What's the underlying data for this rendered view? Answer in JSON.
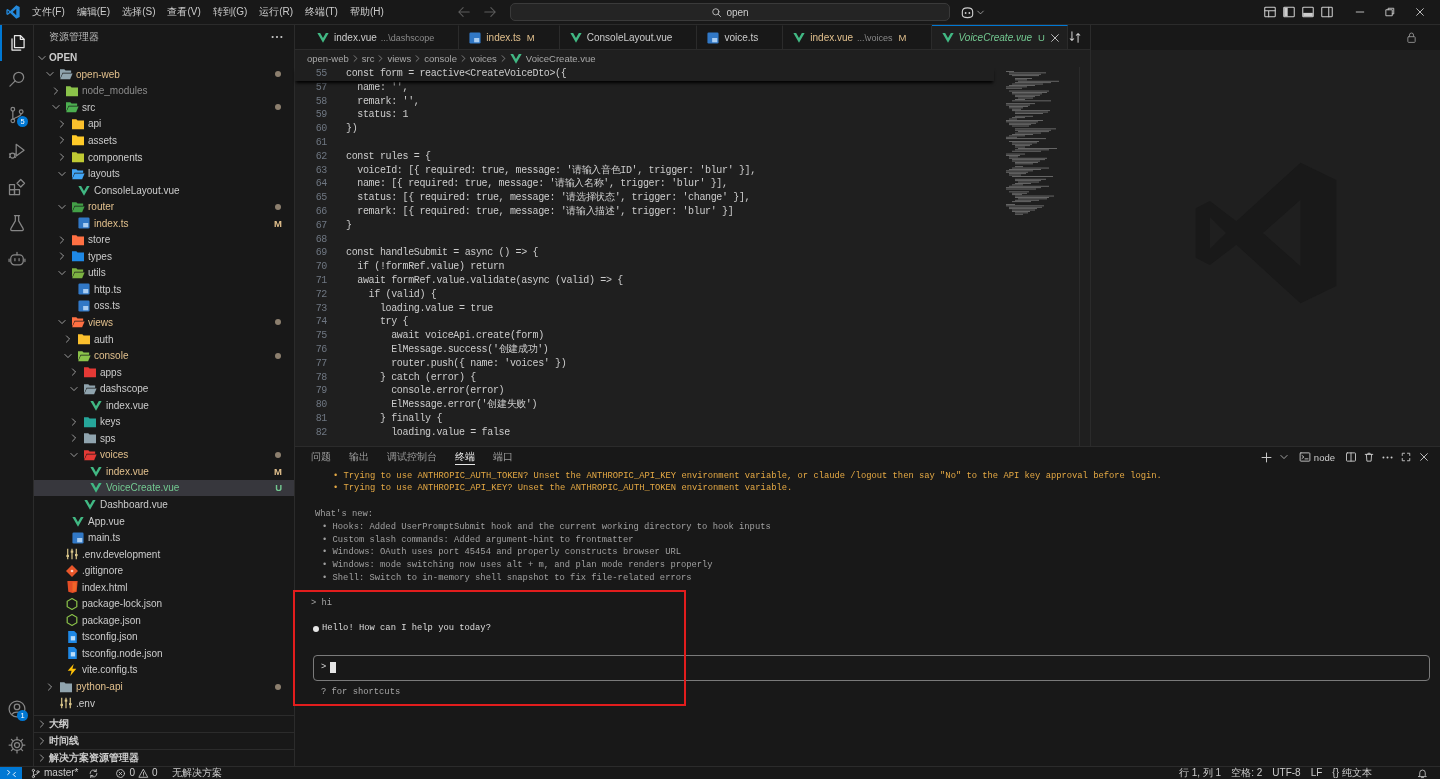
{
  "title_bar": {
    "menu": [
      "文件(F)",
      "编辑(E)",
      "选择(S)",
      "查看(V)",
      "转到(G)",
      "运行(R)",
      "终端(T)",
      "帮助(H)"
    ],
    "nav": [
      {
        "kind": "back",
        "disabled": true
      },
      {
        "kind": "forward",
        "disabled": true
      }
    ],
    "command_center": "open"
  },
  "activity_bar": {
    "top": [
      {
        "kind": "explorer",
        "selected": true
      },
      {
        "kind": "search",
        "selected": false
      },
      {
        "kind": "source-control",
        "selected": false,
        "badge": "5"
      },
      {
        "kind": "run",
        "selected": false
      },
      {
        "kind": "extensions",
        "selected": false
      },
      {
        "kind": "testing",
        "selected": false
      },
      {
        "kind": "chat",
        "selected": false
      }
    ],
    "bottom": [
      {
        "kind": "account",
        "badge": "1"
      },
      {
        "kind": "settings"
      }
    ]
  },
  "sidebar": {
    "title": "资源管理器",
    "sections": [
      {
        "title": "OPEN",
        "expanded": true,
        "tree": [
          {
            "name": "open-web",
            "kind": "folder",
            "color": "#90a4ae",
            "expanded": true,
            "modified": true,
            "dot": true,
            "selected": false,
            "children": [
              {
                "name": "node_modules",
                "kind": "folder",
                "color": "#8bc34a",
                "expanded": false,
                "ignored": true,
                "selected": false
              },
              {
                "name": "src",
                "kind": "folder",
                "color": "#4caf50",
                "expanded": true,
                "dot": true,
                "selected": false,
                "children": [
                  {
                    "name": "api",
                    "kind": "folder",
                    "color": "#fbc02d",
                    "expanded": false,
                    "selected": false
                  },
                  {
                    "name": "assets",
                    "kind": "folder",
                    "color": "#ffca28",
                    "expanded": false,
                    "selected": false
                  },
                  {
                    "name": "components",
                    "kind": "folder",
                    "color": "#c0ca33",
                    "expanded": false,
                    "selected": false
                  },
                  {
                    "name": "layouts",
                    "kind": "folder",
                    "color": "#42a5f5",
                    "expanded": true,
                    "selected": false,
                    "children": [
                      {
                        "name": "ConsoleLayout.vue",
                        "kind": "vue",
                        "selected": false
                      }
                    ]
                  },
                  {
                    "name": "router",
                    "kind": "folder",
                    "color": "#43a047",
                    "expanded": true,
                    "modified": true,
                    "dot": true,
                    "selected": false,
                    "children": [
                      {
                        "name": "index.ts",
                        "kind": "ts",
                        "modified": true,
                        "status": "M",
                        "selected": false
                      }
                    ]
                  },
                  {
                    "name": "store",
                    "kind": "folder",
                    "color": "#ff7043",
                    "expanded": false,
                    "selected": false
                  },
                  {
                    "name": "types",
                    "kind": "folder",
                    "color": "#1e88e5",
                    "expanded": false,
                    "selected": false
                  },
                  {
                    "name": "utils",
                    "kind": "folder",
                    "color": "#7cb342",
                    "expanded": true,
                    "selected": false,
                    "children": [
                      {
                        "name": "http.ts",
                        "kind": "ts",
                        "selected": false
                      },
                      {
                        "name": "oss.ts",
                        "kind": "ts",
                        "selected": false
                      }
                    ]
                  },
                  {
                    "name": "views",
                    "kind": "folder",
                    "color": "#ff7043",
                    "expanded": true,
                    "modified": true,
                    "dot": true,
                    "selected": false,
                    "children": [
                      {
                        "name": "auth",
                        "kind": "folder",
                        "color": "#fbc02d",
                        "expanded": false,
                        "selected": false
                      },
                      {
                        "name": "console",
                        "kind": "folder",
                        "color": "#8bc34a",
                        "expanded": true,
                        "modified": true,
                        "dot": true,
                        "selected": false,
                        "children": [
                          {
                            "name": "apps",
                            "kind": "folder",
                            "color": "#e53935",
                            "expanded": false,
                            "selected": false
                          },
                          {
                            "name": "dashscope",
                            "kind": "folder",
                            "color": "#90a4ae",
                            "expanded": true,
                            "selected": false,
                            "children": [
                              {
                                "name": "index.vue",
                                "kind": "vue",
                                "selected": false
                              }
                            ]
                          },
                          {
                            "name": "keys",
                            "kind": "folder",
                            "color": "#26a69a",
                            "expanded": false,
                            "selected": false
                          },
                          {
                            "name": "sps",
                            "kind": "folder",
                            "color": "#90a4ae",
                            "expanded": false,
                            "selected": false
                          },
                          {
                            "name": "voices",
                            "kind": "folder",
                            "color": "#e53935",
                            "expanded": true,
                            "modified": true,
                            "dot": true,
                            "selected": false,
                            "children": [
                              {
                                "name": "index.vue",
                                "kind": "vue",
                                "modified": true,
                                "status": "M",
                                "selected": false
                              },
                              {
                                "name": "VoiceCreate.vue",
                                "kind": "vue",
                                "untracked": true,
                                "status": "U",
                                "selected": true
                              }
                            ]
                          },
                          {
                            "name": "Dashboard.vue",
                            "kind": "vue",
                            "selected": false
                          }
                        ]
                      }
                    ]
                  },
                  {
                    "name": "App.vue",
                    "kind": "vue",
                    "selected": false
                  },
                  {
                    "name": "main.ts",
                    "kind": "ts",
                    "selected": false
                  }
                ]
              },
              {
                "name": ".env.development",
                "kind": "env",
                "selected": false
              },
              {
                "name": ".gitignore",
                "kind": "git",
                "selected": false
              },
              {
                "name": "index.html",
                "kind": "html",
                "selected": false
              },
              {
                "name": "package-lock.json",
                "kind": "npm",
                "selected": false
              },
              {
                "name": "package.json",
                "kind": "npm",
                "selected": false
              },
              {
                "name": "tsconfig.json",
                "kind": "tsconfig",
                "selected": false
              },
              {
                "name": "tsconfig.node.json",
                "kind": "tsconfig",
                "selected": false
              },
              {
                "name": "vite.config.ts",
                "kind": "vite",
                "selected": false
              }
            ]
          },
          {
            "name": "python-api",
            "kind": "folder",
            "color": "#90a4ae",
            "expanded": false,
            "modified": true,
            "dot": true,
            "selected": false
          },
          {
            "name": ".env",
            "kind": "env",
            "selected": false
          }
        ]
      },
      {
        "title": "大纲",
        "expanded": false
      },
      {
        "title": "时间线",
        "expanded": false
      },
      {
        "title": "解决方案资源管理器",
        "expanded": false
      }
    ]
  },
  "editor": {
    "tabs": [
      {
        "label": "index.vue",
        "description": "...\\dashscope",
        "kind": "vue",
        "selected": false
      },
      {
        "label": "index.ts",
        "kind": "ts",
        "modified": true,
        "status": "M",
        "selected": false
      },
      {
        "label": "ConsoleLayout.vue",
        "kind": "vue",
        "selected": false
      },
      {
        "label": "voice.ts",
        "kind": "ts",
        "selected": false
      },
      {
        "label": "index.vue",
        "description": "...\\voices",
        "kind": "vue",
        "modified": true,
        "status": "M",
        "selected": false
      },
      {
        "label": "VoiceCreate.vue",
        "kind": "vue",
        "untracked": true,
        "status": "U",
        "preview": true,
        "selected": true
      }
    ],
    "breadcrumb": [
      {
        "label": "open-web"
      },
      {
        "label": "src"
      },
      {
        "label": "views"
      },
      {
        "label": "console"
      },
      {
        "label": "voices"
      },
      {
        "label": "VoiceCreate.vue",
        "kind": "vue"
      }
    ],
    "sticky_line": {
      "number": "55",
      "text": "const form = reactive<CreateVoiceDto>({"
    },
    "lines": [
      {
        "number": "57",
        "text": "  name: '',"
      },
      {
        "number": "58",
        "text": "  remark: '',"
      },
      {
        "number": "59",
        "text": "  status: 1"
      },
      {
        "number": "60",
        "text": "})"
      },
      {
        "number": "61"
      },
      {
        "number": "62",
        "text": "const rules = {"
      },
      {
        "number": "63",
        "text": "  voiceId: [{ required: true, message: '请输入音色ID', trigger: 'blur' }],"
      },
      {
        "number": "64",
        "text": "  name: [{ required: true, message: '请输入名称', trigger: 'blur' }],"
      },
      {
        "number": "65",
        "text": "  status: [{ required: true, message: '请选择状态', trigger: 'change' }],"
      },
      {
        "number": "66",
        "text": "  remark: [{ required: true, message: '请输入描述', trigger: 'blur' }]"
      },
      {
        "number": "67",
        "text": "}"
      },
      {
        "number": "68"
      },
      {
        "number": "69",
        "text": "const handleSubmit = async () => {"
      },
      {
        "number": "70",
        "text": "  if (!formRef.value) return"
      },
      {
        "number": "71",
        "text": "  await formRef.value.validate(async (valid) => {"
      },
      {
        "number": "72",
        "text": "    if (valid) {"
      },
      {
        "number": "73",
        "text": "      loading.value = true"
      },
      {
        "number": "74",
        "text": "      try {"
      },
      {
        "number": "75",
        "text": "        await voiceApi.create(form)"
      },
      {
        "number": "76",
        "text": "        ElMessage.success('创建成功')"
      },
      {
        "number": "77",
        "text": "        router.push({ name: 'voices' })"
      },
      {
        "number": "78",
        "text": "      } catch (error) {"
      },
      {
        "number": "79",
        "text": "        console.error(error)"
      },
      {
        "number": "80",
        "text": "        ElMessage.error('创建失败')"
      },
      {
        "number": "81",
        "text": "      } finally {"
      },
      {
        "number": "82",
        "text": "        loading.value = false"
      }
    ]
  },
  "editor_group_2": {
    "locked": true
  },
  "panel": {
    "tabs": [
      {
        "label": "问题",
        "selected": false
      },
      {
        "label": "输出",
        "selected": false
      },
      {
        "label": "调试控制台",
        "selected": false
      },
      {
        "label": "终端",
        "selected": true
      },
      {
        "label": "端口",
        "selected": false
      }
    ],
    "terminal_name": "node",
    "terminal": {
      "warnings": [
        "• Trying to use ANTHROPIC_AUTH_TOKEN? Unset the ANTHROPIC_API_KEY environment variable, or claude /logout then say \"No\" to the API key approval before login.",
        "• Trying to use ANTHROPIC_API_KEY? Unset the ANTHROPIC_AUTH_TOKEN environment variable."
      ],
      "whats_new": {
        "title": "What's new:",
        "items": [
          "• Hooks: Added UserPromptSubmit hook and the current working directory to hook inputs",
          "• Custom slash commands: Added argument-hint to frontmatter",
          "• Windows: OAuth uses port 45454 and properly constructs browser URL",
          "• Windows: mode switching now uses alt + m, and plan mode renders properly",
          "• Shell: Switch to in-memory shell snapshot to fix file-related errors"
        ]
      },
      "chat": {
        "highlighted": true,
        "user_message": "> hi",
        "reply": "Hello! How can I help you today?",
        "prompt": ">",
        "cursor": true,
        "hint": "? for shortcuts"
      }
    }
  },
  "status_bar": {
    "branch": "master*",
    "errors": "0",
    "warnings": "0",
    "solution": "无解决方案",
    "right": [
      {
        "kind": "text",
        "text": "行 1, 列 1"
      },
      {
        "kind": "text",
        "text": "空格: 2"
      },
      {
        "kind": "text",
        "text": "UTF-8"
      },
      {
        "kind": "text",
        "text": "LF"
      },
      {
        "kind": "language",
        "icon": "{}",
        "text": "纯文本"
      },
      {
        "kind": "bell"
      }
    ]
  }
}
